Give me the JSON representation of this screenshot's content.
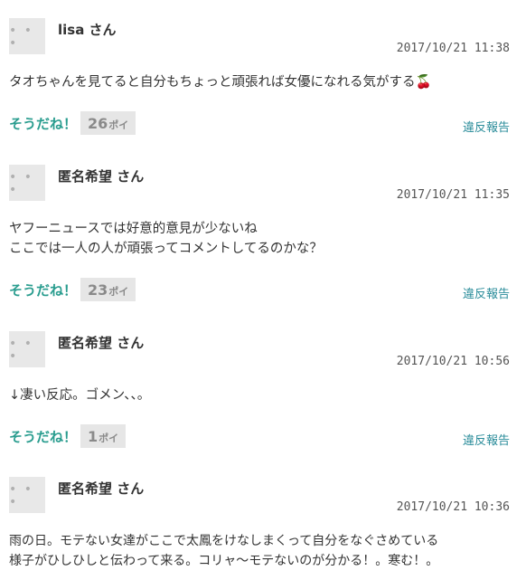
{
  "comments": [
    {
      "username": "lisa さん",
      "timestamp": "2017/10/21 11:38",
      "body": "タオちゃんを見てると自分もちょっと頑張れば女優になれる気がする🍒",
      "like_label": "そうだね！",
      "poi_count": "26",
      "poi_unit": "ポイ",
      "report_label": "違反報告"
    },
    {
      "username": "匿名希望 さん",
      "timestamp": "2017/10/21 11:35",
      "body": "ヤフーニュースでは好意的意見が少ないね\nここでは一人の人が頑張ってコメントしてるのかな？",
      "like_label": "そうだね！",
      "poi_count": "23",
      "poi_unit": "ポイ",
      "report_label": "違反報告"
    },
    {
      "username": "匿名希望 さん",
      "timestamp": "2017/10/21 10:56",
      "body": "↓凄い反応。ゴメン、、。",
      "like_label": "そうだね！",
      "poi_count": "1",
      "poi_unit": "ポイ",
      "report_label": "違反報告"
    },
    {
      "username": "匿名希望 さん",
      "timestamp": "2017/10/21 10:36",
      "body": "雨の日。モテない女達がここで太鳳をけなしまくって自分をなぐさめている\n様子がひしひしと伝わって来る。コリャ〜モテないのが分かる！。寒む！。",
      "like_label": "",
      "poi_count": "",
      "poi_unit": "",
      "report_label": ""
    }
  ],
  "avatar_placeholder": "• • •",
  "colors": {
    "accent": "#2a9d8f",
    "report": "#2a8c9a",
    "badge_bg": "#e6e6e6",
    "avatar_bg": "#e8e8e8"
  }
}
